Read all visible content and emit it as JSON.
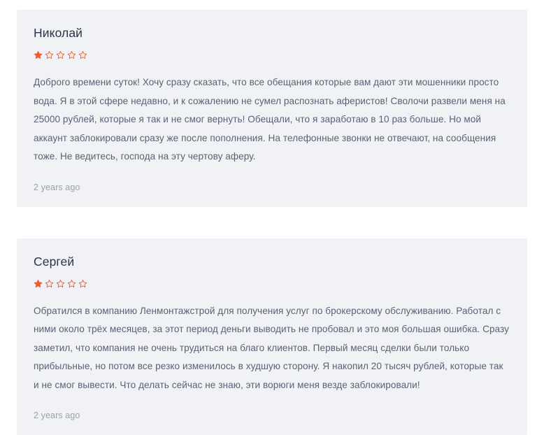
{
  "page": {
    "background_color": "#ffffff",
    "card_background_color": "#f1f2f6",
    "star_color": "#f9572a",
    "author_color": "#2c3445",
    "text_color": "#596274",
    "date_color": "#9aa1ad"
  },
  "icons": {
    "star_filled": "star-filled-icon",
    "star_empty": "star-outline-icon"
  },
  "reviews": [
    {
      "author": "Николай",
      "rating": 1,
      "max_rating": 5,
      "text": "Доброго времени суток! Хочу сразу сказать, что все обещания которые вам дают эти мошенники просто вода. Я в этой сфере недавно, и к сожалению не сумел распознать аферистов! Сволочи развели меня на 25000 рублей, которые я так и не смог вернуть! Обещали, что я заработаю в 10 раз больше. Но мой аккаунт заблокировали сразу же после пополнения. На телефонные звонки не отвечают, на сообщения тоже. Не ведитесь, господа на эту чертову аферу.",
      "date": "2 years ago"
    },
    {
      "author": "Сергей",
      "rating": 1,
      "max_rating": 5,
      "text": "Обратился в компанию Ленмонтажстрой для получения услуг по брокерскому обслуживанию. Работал с ними около трёх месяцев, за этот период деньги выводить не пробовал и это моя большая ошибка. Сразу заметил, что компания не очень трудиться на благо клиентов. Первый месяц сделки были только прибыльные, но потом все резко изменилось в худшую сторону. Я накопил 20 тысяч рублей, которые так и не смог вывести. Что делать сейчас не знаю, эти ворюги меня везде заблокировали!",
      "date": "2 years ago"
    }
  ]
}
